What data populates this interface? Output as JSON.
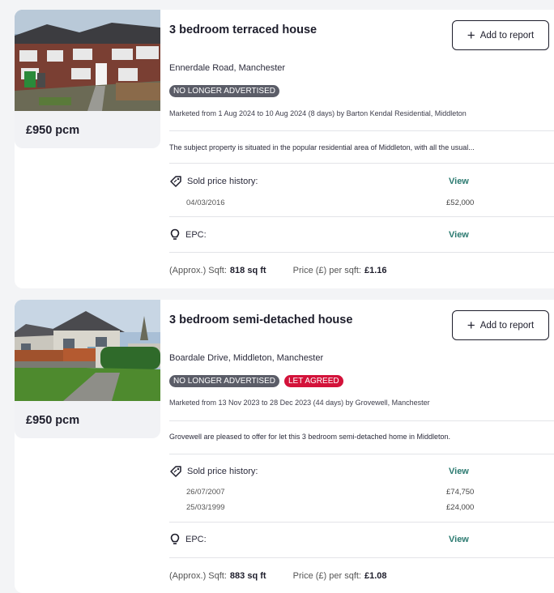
{
  "listings": [
    {
      "price": "£950 pcm",
      "title": "3 bedroom terraced house",
      "report_button": "Add to report",
      "address": "Ennerdale Road, Manchester",
      "badges": [
        "NO LONGER ADVERTISED"
      ],
      "marketed": "Marketed from 1 Aug 2024 to 10 Aug 2024 (8 days) by Barton Kendal Residential, Middleton",
      "description": "The subject property is situated in the popular residential area of Middleton, with all the usual...",
      "sold_label": "Sold price history:",
      "sold_view": "View",
      "sold_history": [
        {
          "date": "04/03/2016",
          "price": "£52,000"
        }
      ],
      "epc_label": "EPC:",
      "epc_view": "View",
      "sqft_label": "(Approx.) Sqft:",
      "sqft_value": "818 sq ft",
      "ppsqft_label": "Price (£) per sqft:",
      "ppsqft_value": "£1.16"
    },
    {
      "price": "£950 pcm",
      "title": "3 bedroom semi-detached house",
      "report_button": "Add to report",
      "address": "Boardale Drive, Middleton, Manchester",
      "badges": [
        "NO LONGER ADVERTISED",
        "LET AGREED"
      ],
      "marketed": "Marketed from 13 Nov 2023 to 28 Dec 2023 (44 days) by Grovewell, Manchester",
      "description": "Grovewell are pleased to offer for let this 3 bedroom semi-detached home in Middleton.",
      "sold_label": "Sold price history:",
      "sold_view": "View",
      "sold_history": [
        {
          "date": "26/07/2007",
          "price": "£74,750"
        },
        {
          "date": "25/03/1999",
          "price": "£24,000"
        }
      ],
      "epc_label": "EPC:",
      "epc_view": "View",
      "sqft_label": "(Approx.) Sqft:",
      "sqft_value": "883 sq ft",
      "ppsqft_label": "Price (£) per sqft:",
      "ppsqft_value": "£1.08"
    }
  ],
  "colors": {
    "link": "#2b7a70",
    "badge_grey": "#5b5d68",
    "badge_red": "#d3123a"
  }
}
